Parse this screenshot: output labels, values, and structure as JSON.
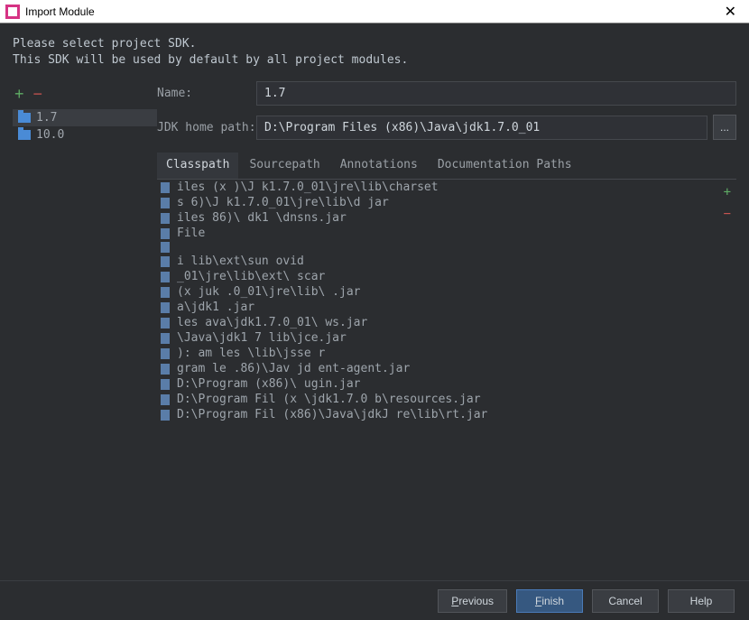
{
  "window": {
    "title": "Import Module"
  },
  "instructions": {
    "line1": "Please select project SDK.",
    "line2": "This SDK will be used by default by all project modules."
  },
  "sidebar": {
    "items": [
      {
        "label": "1.7",
        "selected": true
      },
      {
        "label": "10.0",
        "selected": false
      }
    ]
  },
  "form": {
    "name_label": "Name:",
    "name_value": "1.7",
    "path_label": "JDK home path:",
    "path_value": "D:\\Program Files (x86)\\Java\\jdk1.7.0_01",
    "browse": "..."
  },
  "tabs": [
    {
      "label": "Classpath",
      "active": true
    },
    {
      "label": "Sourcepath",
      "active": false
    },
    {
      "label": "Annotations",
      "active": false
    },
    {
      "label": "Documentation Paths",
      "active": false
    }
  ],
  "classpath": [
    "            iles (x   )\\J    k1.7.0_01\\jre\\lib\\charset",
    "            s    6)\\J    k1.7.0_01\\jre\\lib\\d      jar",
    "         iles   86)\\     dk1                  \\dnsns.jar",
    "         File",
    "",
    "            i                       lib\\ext\\sun    ovid",
    "                           _01\\jre\\lib\\ext\\   scar",
    "             (x       juk   .0_01\\jre\\lib\\          .jar",
    "                   a\\jdk1                        .jar",
    "         les      ava\\jdk1.7.0_01\\              ws.jar",
    "                 \\Java\\jdk1 7         lib\\jce.jar",
    "  ):      am   les                    \\lib\\jsse    r",
    "      gram  le   .86)\\Jav            jd          ent-agent.jar",
    "D:\\Program     (x86)\\                         ugin.jar",
    "D:\\Program Fil   (x      \\jdk1.7.0         b\\resources.jar",
    "D:\\Program Fil   (x86)\\Java\\jdkJ       re\\lib\\rt.jar"
  ],
  "buttons": {
    "previous": "Previous",
    "finish": "Finish",
    "cancel": "Cancel",
    "help": "Help"
  }
}
